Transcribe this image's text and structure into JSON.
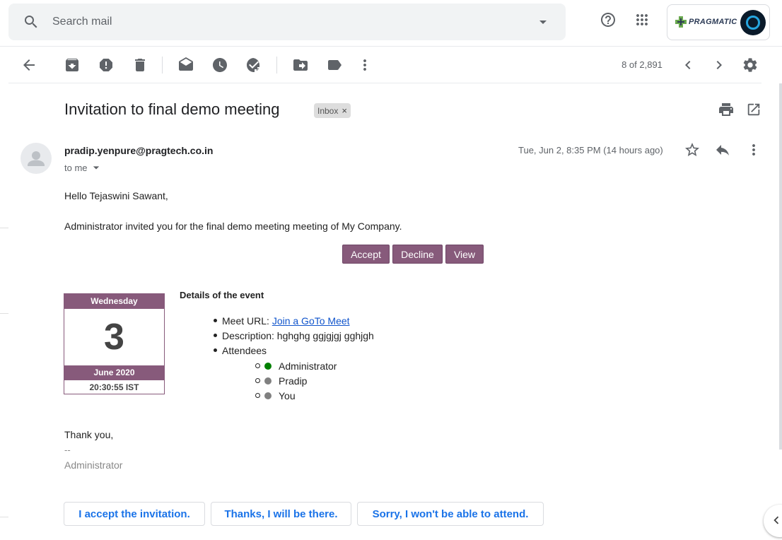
{
  "search": {
    "placeholder": "Search mail"
  },
  "header": {
    "brand": {
      "name": "PRAGMATIC"
    }
  },
  "toolbar": {
    "page_count": "8 of 2,891"
  },
  "message": {
    "subject": "Invitation to final demo meeting",
    "label": "Inbox",
    "label_close": "×",
    "sender_email": "pradip.yenpure@pragtech.co.in",
    "recipient": "to me",
    "date": "Tue, Jun 2, 8:35 PM (14 hours ago)",
    "greeting": "Hello Tejaswini Sawant,",
    "intro": "Administrator invited you for the final demo meeting meeting of My Company.",
    "actions": {
      "accept": "Accept",
      "decline": "Decline",
      "view": "View"
    },
    "calendar": {
      "weekday": "Wednesday",
      "day": "3",
      "month_year": "June 2020",
      "time": "20:30:55 IST"
    },
    "details": {
      "title": "Details of the event",
      "meet_url_label": "Meet URL:",
      "meet_url_link": "Join a GoTo Meet",
      "description": "Description: hghghg ggjgjgj gghjgh",
      "attendees_label": "Attendees",
      "attendees": [
        {
          "name": "Administrator",
          "status_color": "#008000"
        },
        {
          "name": "Pradip",
          "status_color": "#808080"
        },
        {
          "name": "You",
          "status_color": "#808080"
        }
      ]
    },
    "signoff": "Thank you,",
    "sig_separator": "--",
    "signature": "Administrator"
  },
  "smart_replies": [
    "I accept the invitation.",
    "Thanks, I will be there.",
    "Sorry, I won't be able to attend."
  ],
  "colors": {
    "accent": "#875a7b",
    "link": "#1155cc",
    "smart_reply": "#1a73e8"
  },
  "icons": [
    "search-icon",
    "search-options-icon",
    "help-icon",
    "apps-grid-icon",
    "back-arrow-icon",
    "archive-icon",
    "report-spam-icon",
    "delete-icon",
    "mark-unread-icon",
    "snooze-icon",
    "add-task-icon",
    "move-to-icon",
    "label-icon",
    "more-vert-icon",
    "chevron-left-icon",
    "chevron-right-icon",
    "settings-gear-icon",
    "print-icon",
    "open-new-window-icon",
    "star-icon",
    "reply-icon",
    "chevron-left-small-icon"
  ]
}
